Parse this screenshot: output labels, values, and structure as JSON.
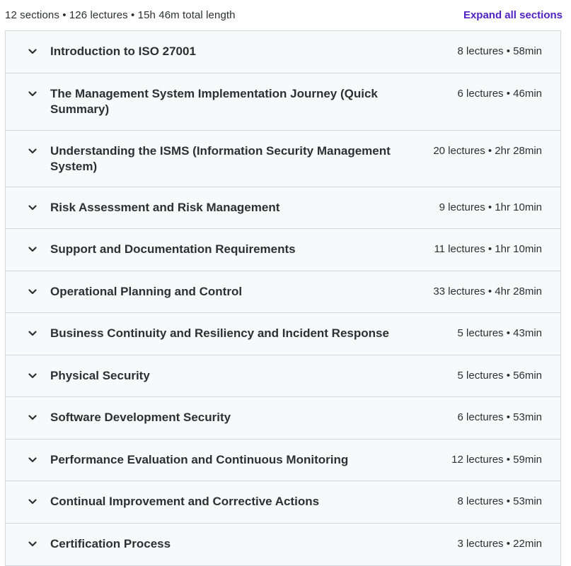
{
  "summary": {
    "text": "12 sections • 126 lectures • 15h 46m total length",
    "expand_label": "Expand all sections"
  },
  "colors": {
    "accent": "#5022c3",
    "section_background": "#f7f9fa",
    "border": "#d1d7dc",
    "text": "#2d2f31"
  },
  "sections": [
    {
      "title": "Introduction to ISO 27001",
      "meta": "8 lectures • 58min",
      "icon": "chevron-down-icon"
    },
    {
      "title": "The Management System Implementation Journey (Quick Summary)",
      "meta": "6 lectures • 46min",
      "icon": "chevron-down-icon"
    },
    {
      "title": "Understanding the ISMS (Information Security Management System)",
      "meta": "20 lectures • 2hr 28min",
      "icon": "chevron-down-icon"
    },
    {
      "title": "Risk Assessment and Risk Management",
      "meta": "9 lectures • 1hr 10min",
      "icon": "chevron-down-icon"
    },
    {
      "title": "Support and Documentation Requirements",
      "meta": "11 lectures • 1hr 10min",
      "icon": "chevron-down-icon"
    },
    {
      "title": "Operational Planning and Control",
      "meta": "33 lectures • 4hr 28min",
      "icon": "chevron-down-icon"
    },
    {
      "title": "Business Continuity and Resiliency and Incident Response",
      "meta": "5 lectures • 43min",
      "icon": "chevron-down-icon"
    },
    {
      "title": "Physical Security",
      "meta": "5 lectures • 56min",
      "icon": "chevron-down-icon"
    },
    {
      "title": "Software Development Security",
      "meta": "6 lectures • 53min",
      "icon": "chevron-down-icon"
    },
    {
      "title": "Performance Evaluation and Continuous Monitoring",
      "meta": "12 lectures • 59min",
      "icon": "chevron-down-icon"
    },
    {
      "title": "Continual Improvement and Corrective Actions",
      "meta": "8 lectures • 53min",
      "icon": "chevron-down-icon"
    },
    {
      "title": "Certification Process",
      "meta": "3 lectures • 22min",
      "icon": "chevron-down-icon"
    }
  ]
}
